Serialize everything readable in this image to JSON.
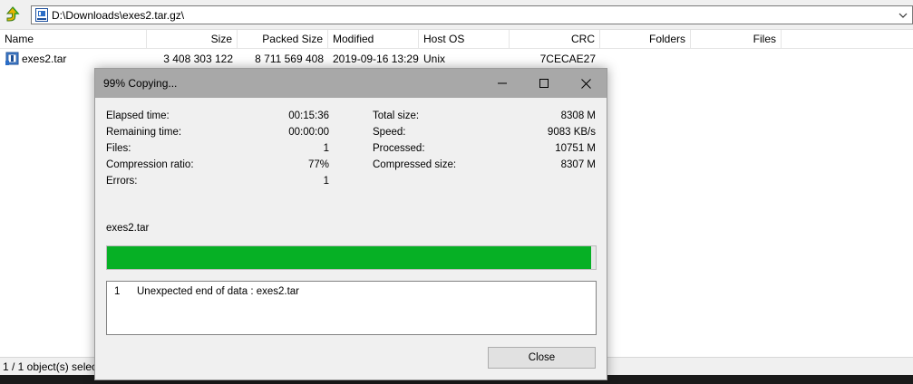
{
  "address": {
    "path": "D:\\Downloads\\exes2.tar.gz\\"
  },
  "columns": [
    "Name",
    "Size",
    "Packed Size",
    "Modified",
    "Host OS",
    "CRC",
    "Folders",
    "Files"
  ],
  "files": [
    {
      "name": "exes2.tar",
      "size": "3 408 303 122",
      "packed_size": "8 711 569 408",
      "modified": "2019-09-16 13:29",
      "host_os": "Unix",
      "crc": "7CECAE27",
      "folders": "",
      "files": ""
    }
  ],
  "status": {
    "text": "1 / 1 object(s) selec"
  },
  "dialog": {
    "title": "99% Copying...",
    "left_stats": [
      {
        "label": "Elapsed time:",
        "value": "00:15:36"
      },
      {
        "label": "Remaining time:",
        "value": "00:00:00"
      },
      {
        "label": "Files:",
        "value": "1"
      },
      {
        "label": "Compression ratio:",
        "value": "77%"
      },
      {
        "label": "Errors:",
        "value": "1"
      }
    ],
    "right_stats": [
      {
        "label": "Total size:",
        "value": "8308 M"
      },
      {
        "label": "Speed:",
        "value": "9083 KB/s"
      },
      {
        "label": "Processed:",
        "value": "10751 M"
      },
      {
        "label": "Compressed size:",
        "value": "8307 M"
      }
    ],
    "current_file": "exes2.tar",
    "progress_percent": 99,
    "progress_color": "#06b025",
    "messages": [
      {
        "num": "1",
        "text": "Unexpected end of data : exes2.tar"
      }
    ],
    "close_label": "Close"
  },
  "icons": {
    "up": "up-arrow-icon",
    "address": "archive-icon",
    "dropdown": "chevron-down-icon",
    "file": "tar-file-icon",
    "minimize": "minimize-icon",
    "maximize": "maximize-icon",
    "close": "close-icon"
  }
}
